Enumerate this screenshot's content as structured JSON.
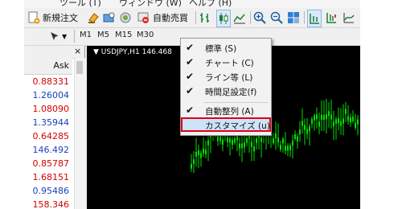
{
  "menubar": {
    "items": [
      {
        "label": "ツール (T)"
      },
      {
        "label": "ウィンドウ (W)"
      },
      {
        "label": "ヘルプ (H)"
      }
    ]
  },
  "toolbar": {
    "new_order_label": "新規注文",
    "auto_trade_label": "自動売買"
  },
  "timeframes": [
    "M1",
    "M5",
    "M15",
    "M30"
  ],
  "market_watch": {
    "ask_header": "Ask",
    "rows": [
      {
        "ask": "0.88331",
        "color": "#d40000"
      },
      {
        "ask": "1.26004",
        "color": "#1a3fbf"
      },
      {
        "ask": "1.08090",
        "color": "#d40000"
      },
      {
        "ask": "1.35944",
        "color": "#1a3fbf"
      },
      {
        "ask": "0.64285",
        "color": "#d40000"
      },
      {
        "ask": "146.492",
        "color": "#1a3fbf"
      },
      {
        "ask": "0.85787",
        "color": "#d40000"
      },
      {
        "ask": "1.68151",
        "color": "#d40000"
      },
      {
        "ask": "0.95486",
        "color": "#1a3fbf"
      },
      {
        "ask": "158.346",
        "color": "#d40000"
      }
    ]
  },
  "chart": {
    "title": "USDJPY,H1  146.468",
    "bg_color": "#000000",
    "candle_color": "#00e000"
  },
  "context_menu": {
    "items": [
      {
        "label": "標準 (S)",
        "checked": true
      },
      {
        "label": "チャート (C)",
        "checked": true
      },
      {
        "label": "ライン等 (L)",
        "checked": true
      },
      {
        "label": "時間足設定(f)",
        "checked": true
      },
      {
        "label": "自動整列 (A)",
        "checked": true
      },
      {
        "label": "カスタマイズ (u)",
        "checked": false,
        "highlighted": true
      }
    ],
    "highlight_color": "#e0001a"
  }
}
